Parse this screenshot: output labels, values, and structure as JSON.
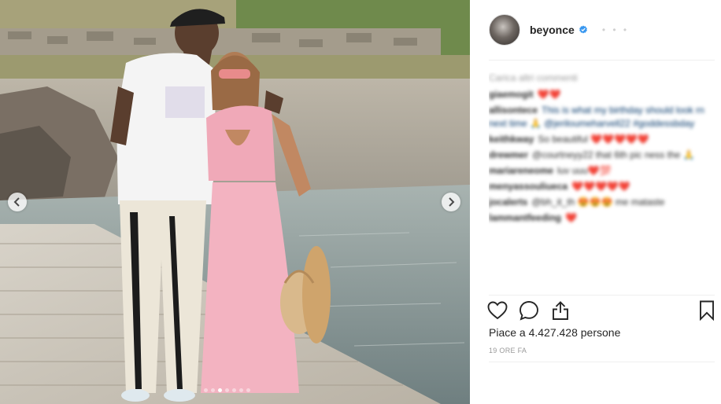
{
  "post": {
    "username": "beyonce",
    "verified": true,
    "load_more_label": "Carica altri commenti",
    "comments": [
      {
        "user": "giaemogit",
        "text": "❤️❤️"
      },
      {
        "user": "allisontece",
        "text": "This is what my birthday should look rn next time 🙏 @jeriloumeharvell22 #goddessbday"
      },
      {
        "user": "keithkway",
        "text": "So beautiful ❤️❤️❤️❤️❤️"
      },
      {
        "user": "drewmer",
        "text": "@courtneyy22 that 6th pic ness the 🙏"
      },
      {
        "user": "mariareneome",
        "text": "luv uuu❤️💯"
      },
      {
        "user": "menyassouliueca",
        "text": "❤️❤️❤️❤️❤️"
      },
      {
        "user": "jocalerts",
        "text": "@bh_it_th 😍😍😍 me mataste"
      },
      {
        "user": "lammantfeeding",
        "text": "❤️"
      }
    ],
    "likes_text": "Piace a 4.427.428 persone",
    "time_text": "19 ORE FA"
  },
  "icons": {
    "verified": "verified-badge-icon",
    "more": "more-options-icon",
    "like": "heart-icon",
    "comment": "comment-bubble-icon",
    "share": "share-icon",
    "save": "bookmark-icon",
    "prev": "chevron-left-icon",
    "next": "chevron-right-icon"
  },
  "carousel": {
    "slide_count": 7,
    "active_index": 0
  },
  "colors": {
    "text": "#262626",
    "muted": "#999999",
    "verified": "#3897f0",
    "divider": "#efefef"
  }
}
